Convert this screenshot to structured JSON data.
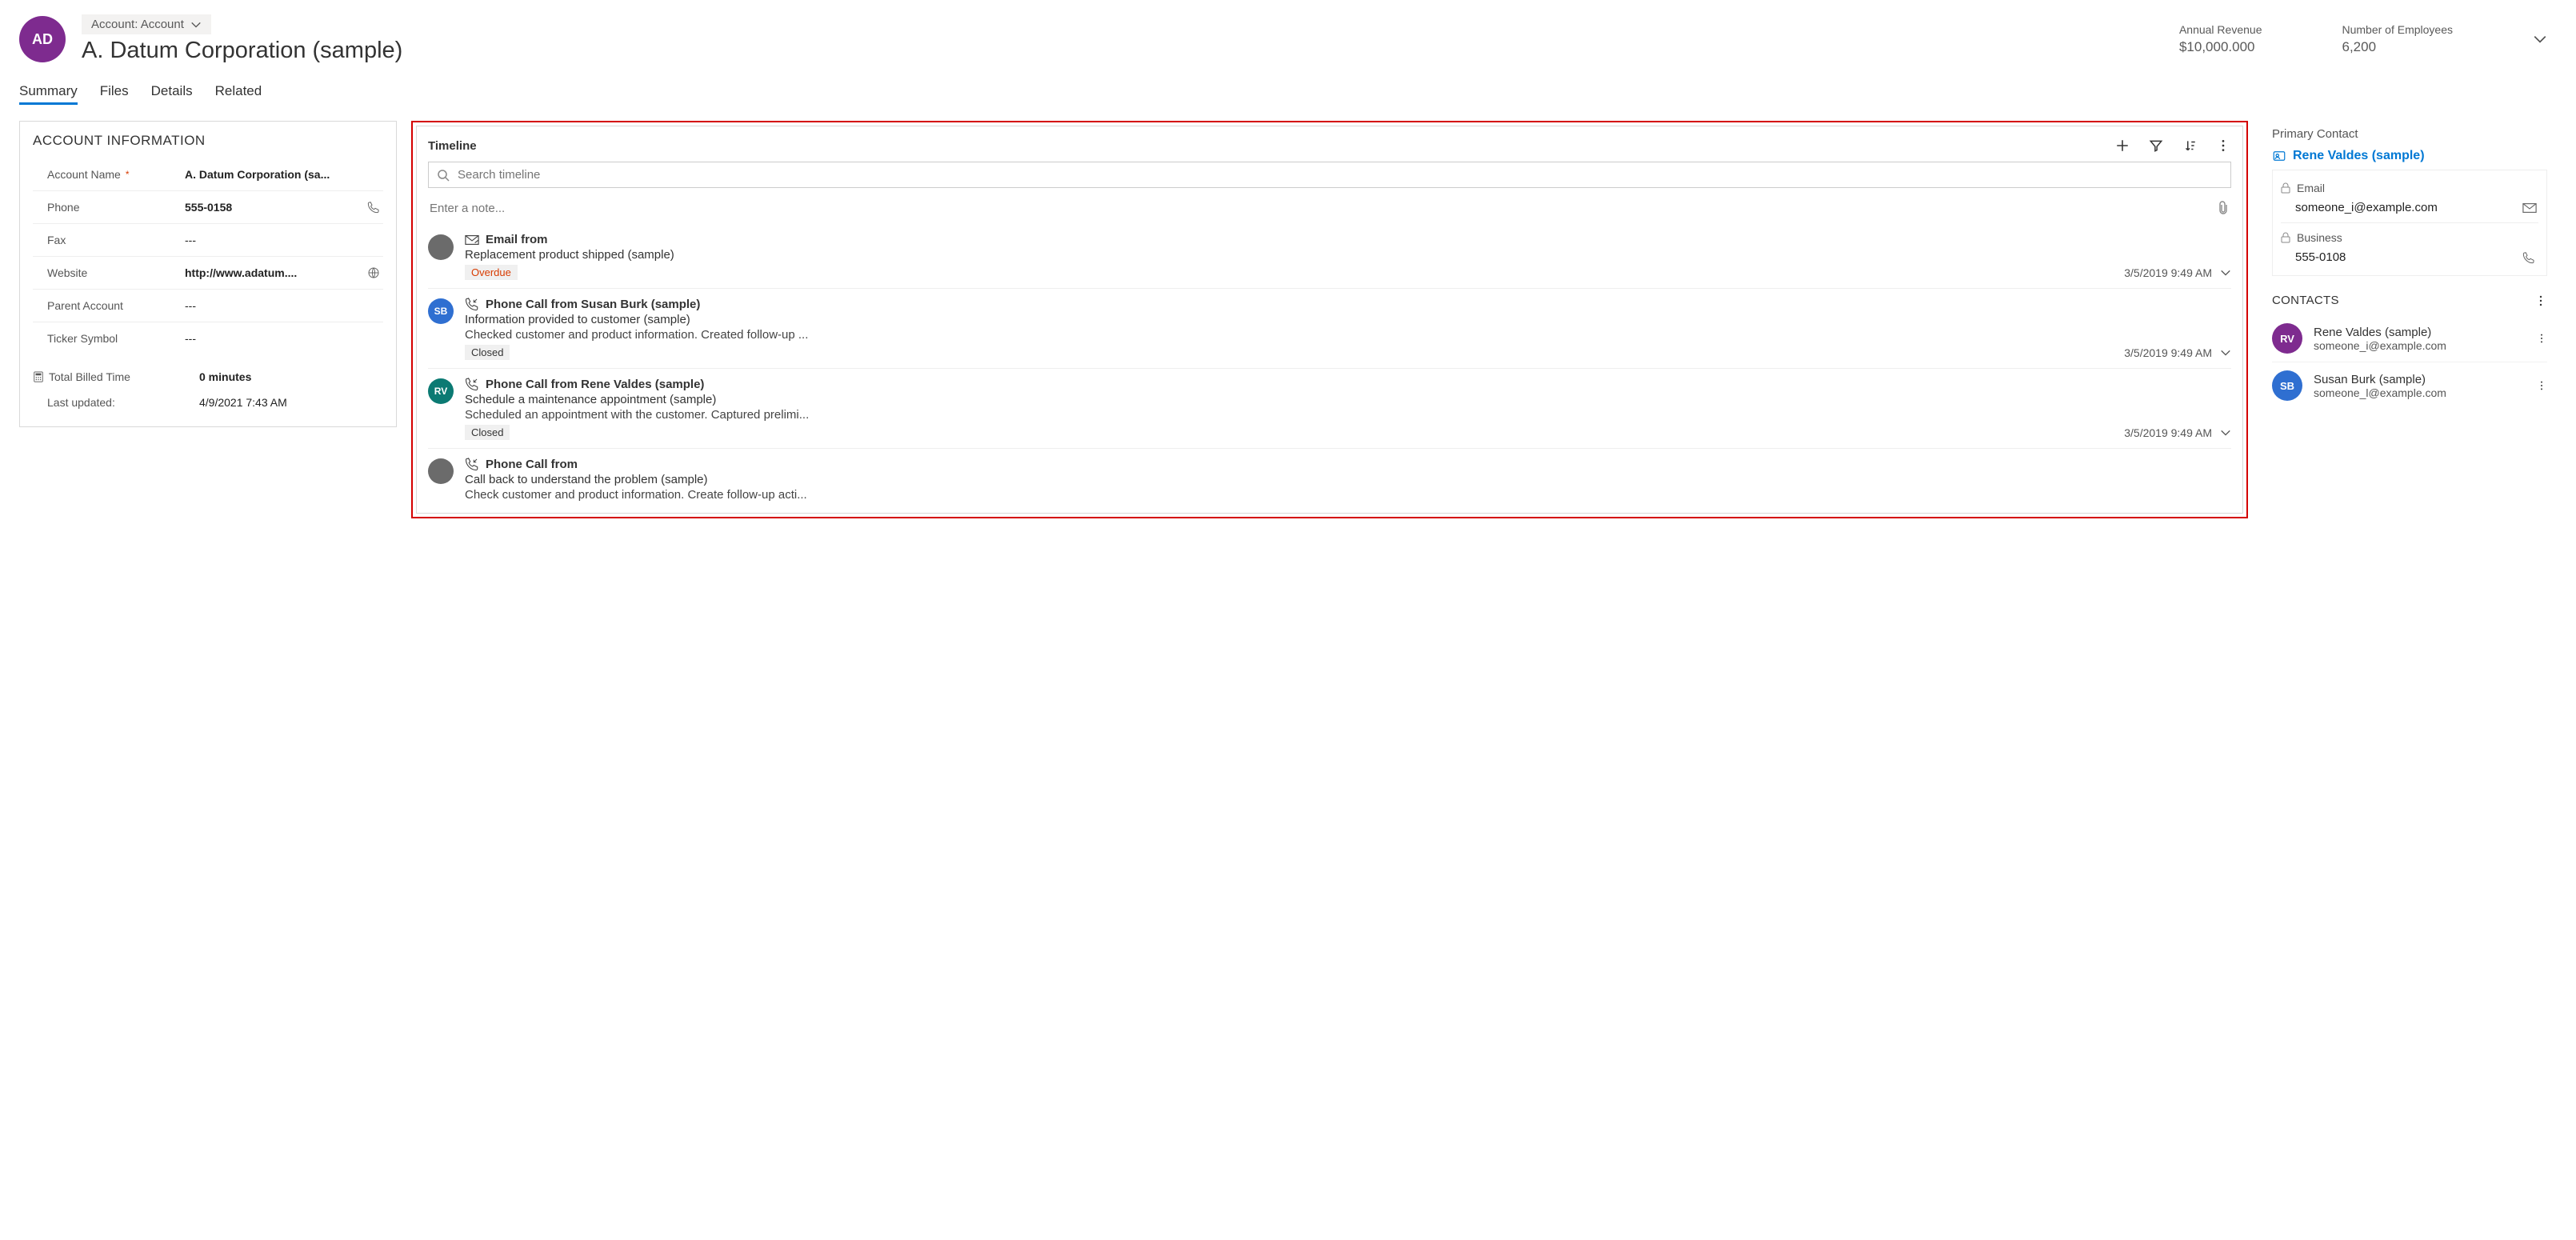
{
  "header": {
    "avatar_initials": "AD",
    "entity_chip": "Account: Account",
    "entity_name": "A. Datum Corporation (sample)",
    "metrics": [
      {
        "label": "Annual Revenue",
        "value": "$10,000.000"
      },
      {
        "label": "Number of Employees",
        "value": "6,200"
      }
    ]
  },
  "tabs": [
    "Summary",
    "Files",
    "Details",
    "Related"
  ],
  "active_tab": "Summary",
  "account_info": {
    "section_title": "ACCOUNT INFORMATION",
    "fields": {
      "account_name": {
        "label": "Account Name",
        "value": "A. Datum Corporation (sa...",
        "required": true
      },
      "phone": {
        "label": "Phone",
        "value": "555-0158"
      },
      "fax": {
        "label": "Fax",
        "value": "---"
      },
      "website": {
        "label": "Website",
        "value": "http://www.adatum...."
      },
      "parent_account": {
        "label": "Parent Account",
        "value": "---"
      },
      "ticker": {
        "label": "Ticker Symbol",
        "value": "---"
      }
    },
    "billed": {
      "label": "Total Billed Time",
      "value": "0 minutes"
    },
    "updated": {
      "label": "Last updated:",
      "value": "4/9/2021 7:43 AM"
    }
  },
  "timeline": {
    "title": "Timeline",
    "search_placeholder": "Search timeline",
    "note_placeholder": "Enter a note...",
    "items": [
      {
        "avatar_initials": "",
        "avatar_color": "#6b6b6b",
        "icon": "email",
        "title": "Email from",
        "subtitle": "Replacement product shipped (sample)",
        "description": "",
        "badge": "Overdue",
        "badge_kind": "overdue",
        "time": "3/5/2019 9:49 AM"
      },
      {
        "avatar_initials": "SB",
        "avatar_color": "#2f6fd1",
        "icon": "phone",
        "title": "Phone Call from Susan Burk (sample)",
        "subtitle": "Information provided to customer (sample)",
        "description": "Checked customer and product information. Created follow-up ...",
        "badge": "Closed",
        "badge_kind": "closed",
        "time": "3/5/2019 9:49 AM"
      },
      {
        "avatar_initials": "RV",
        "avatar_color": "#0b7a73",
        "icon": "phone",
        "title": "Phone Call from Rene Valdes (sample)",
        "subtitle": "Schedule a maintenance appointment (sample)",
        "description": "Scheduled an appointment with the customer. Captured prelimi...",
        "badge": "Closed",
        "badge_kind": "closed",
        "time": "3/5/2019 9:49 AM"
      },
      {
        "avatar_initials": "",
        "avatar_color": "#6b6b6b",
        "icon": "phone",
        "title": "Phone Call from",
        "subtitle": "Call back to understand the problem (sample)",
        "description": "Check customer and product information. Create follow-up acti...",
        "badge": "",
        "badge_kind": "",
        "time": ""
      }
    ]
  },
  "primary_contact": {
    "section_title": "Primary Contact",
    "name": "Rene Valdes (sample)",
    "email_label": "Email",
    "email_value": "someone_i@example.com",
    "business_label": "Business",
    "business_value": "555-0108"
  },
  "contacts": {
    "section_title": "CONTACTS",
    "items": [
      {
        "initials": "RV",
        "color": "#7e2b8f",
        "name": "Rene Valdes (sample)",
        "email": "someone_i@example.com"
      },
      {
        "initials": "SB",
        "color": "#2f6fd1",
        "name": "Susan Burk (sample)",
        "email": "someone_l@example.com"
      }
    ]
  }
}
